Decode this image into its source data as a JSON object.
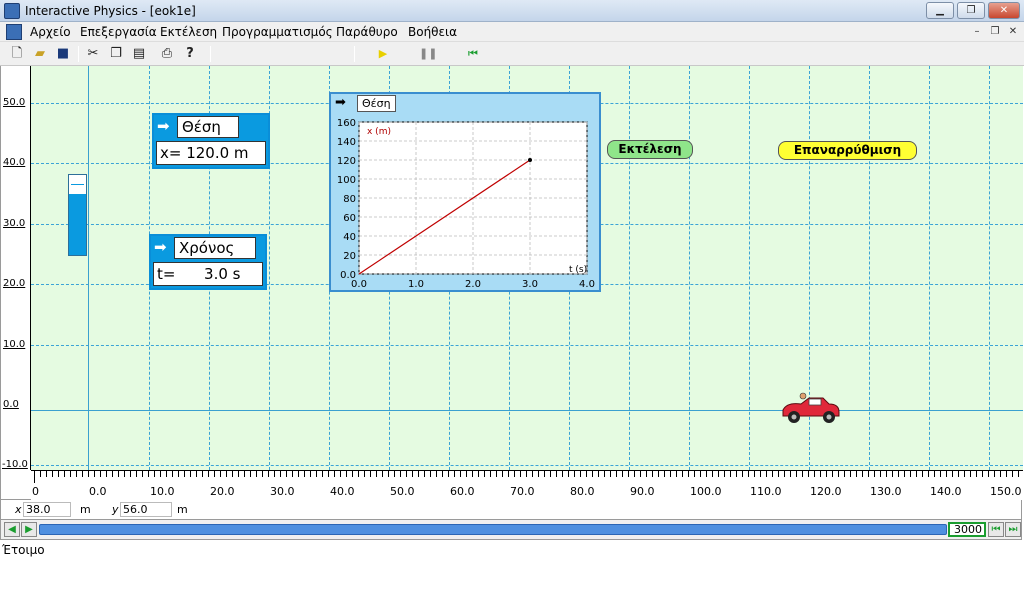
{
  "window": {
    "title": "Interactive Physics - [eok1e]",
    "minimize": "▁",
    "maximize": "❐",
    "close": "✕"
  },
  "menu": {
    "items": [
      "Αρχείο",
      "Επεξεργασία",
      "Εκτέλεση",
      "Προγραμματισμός",
      "Παράθυρο",
      "Βοήθεια"
    ]
  },
  "toolbar": {
    "icons": [
      "new-file-icon",
      "open-folder-icon",
      "save-icon",
      "cut-icon",
      "copy-icon",
      "paste-icon",
      "print-icon",
      "help-icon",
      "run-icon",
      "pause-icon",
      "reset-icon"
    ]
  },
  "workspace": {
    "y_labels": [
      "50.0",
      "40.0",
      "30.0",
      "20.0",
      "10.0",
      "0.0",
      "-10.0"
    ],
    "x_labels": [
      "0",
      "0.0",
      "10.0",
      "20.0",
      "30.0",
      "40.0",
      "50.0",
      "60.0",
      "70.0",
      "80.0",
      "90.0",
      "100.0",
      "110.0",
      "120.0",
      "130.0",
      "140.0",
      "150.0"
    ]
  },
  "meters": {
    "position": {
      "title": "Θέση",
      "value": "x= 120.0 m"
    },
    "time": {
      "title": "Χρόνος",
      "value": "t=      3.0 s"
    }
  },
  "graph": {
    "title": "Θέση",
    "y_unit_label": "x (m)",
    "x_unit_label": "t (s)",
    "y_ticks": [
      "160",
      "140",
      "120",
      "100",
      "80",
      "60",
      "40",
      "20",
      "0.0"
    ],
    "x_ticks": [
      "0.0",
      "1.0",
      "2.0",
      "3.0",
      "4.0"
    ]
  },
  "chart_data": {
    "type": "line",
    "xlabel": "t (s)",
    "ylabel": "x (m)",
    "xlim": [
      0,
      4
    ],
    "ylim": [
      0,
      160
    ],
    "series": [
      {
        "x": [
          0,
          3.0
        ],
        "y": [
          0,
          120
        ],
        "color": "#c00000"
      }
    ]
  },
  "buttons": {
    "run": "Εκτέλεση",
    "reset": "Επαναρρύθμιση"
  },
  "coords": {
    "x_label": "x",
    "x_value": "38.0",
    "x_unit": "m",
    "y_label": "y",
    "y_value": "56.0",
    "y_unit": "m"
  },
  "timebar": {
    "frame": "3000"
  },
  "status": {
    "text": "Έτοιμο"
  },
  "colors": {
    "workspace_bg": "#e5fbe1",
    "meter_blue": "#0a9ae0",
    "run_green": "#8fe58a",
    "reset_yellow": "#ffff33",
    "grid": "#3ba3d6"
  }
}
